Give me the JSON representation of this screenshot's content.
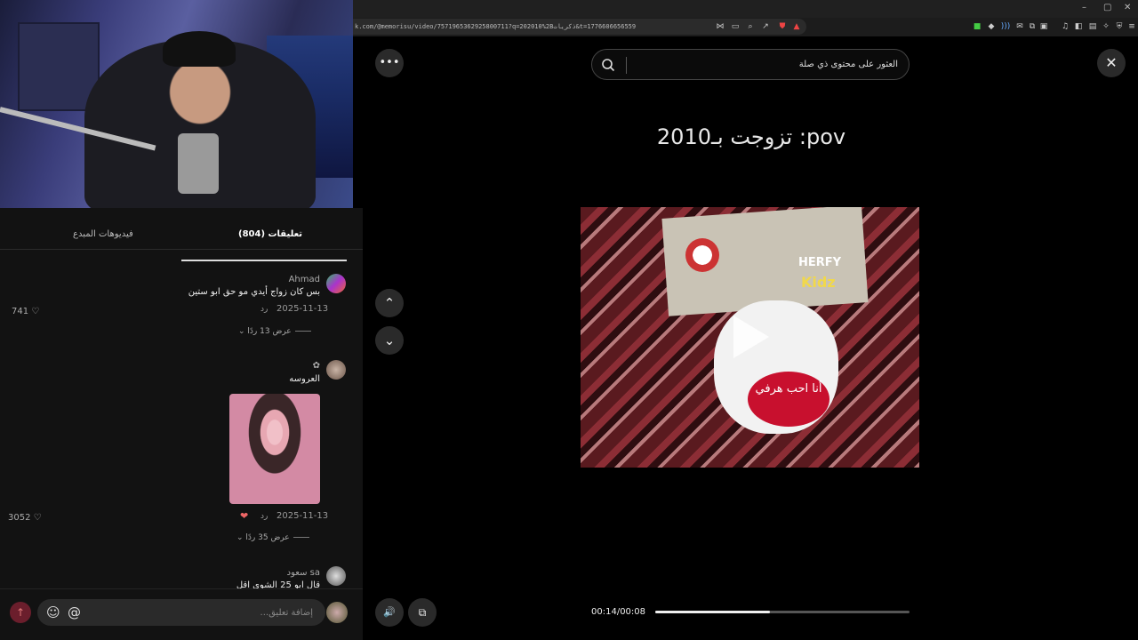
{
  "browser": {
    "url": "k.com/@memorisu/video/7571965362925800711?q=202010%2Bذكريات&t=1776606656559",
    "window_controls": [
      "–",
      "▢",
      "✕"
    ]
  },
  "comments_panel": {
    "tabs": [
      {
        "label": "(804) تعليقات",
        "active": true
      },
      {
        "label": "فيديوهات المبدع",
        "active": false
      }
    ],
    "comments": [
      {
        "author": "Ahmad",
        "text": "بس كان زواج أيدي مو حق ابو ستين",
        "date": "2025-11-13",
        "reply_label": "رد",
        "likes": "741",
        "more_replies": "عرض 13 ردًا"
      },
      {
        "author": "✿",
        "text": "العروسه",
        "date": "2025-11-13",
        "reply_label": "رد",
        "likes": "3052",
        "more_replies": "عرض 35 ردًا"
      },
      {
        "author": "سعود sa",
        "text": "قال ابو 25 الشوي اقل"
      }
    ],
    "comment_input": {
      "placeholder": "إضافة تعليق...",
      "value": ""
    },
    "emoji_icon": "☺",
    "mention_icon": "@"
  },
  "player": {
    "search": {
      "placeholder": "العثور على محتوى ذي صلة",
      "value": ""
    },
    "caption": "تزوجت بـ2010 :pov",
    "video_text": {
      "herfy": "HERFY",
      "kidz": "Kidz",
      "heart": "أنا احب هرفي"
    },
    "time": "00:14/00:08",
    "progress": 0.45,
    "icons": {
      "more": "•••",
      "close": "✕",
      "up": "⌃",
      "down": "⌄",
      "volume": "🔊",
      "pip": "⧉"
    }
  }
}
